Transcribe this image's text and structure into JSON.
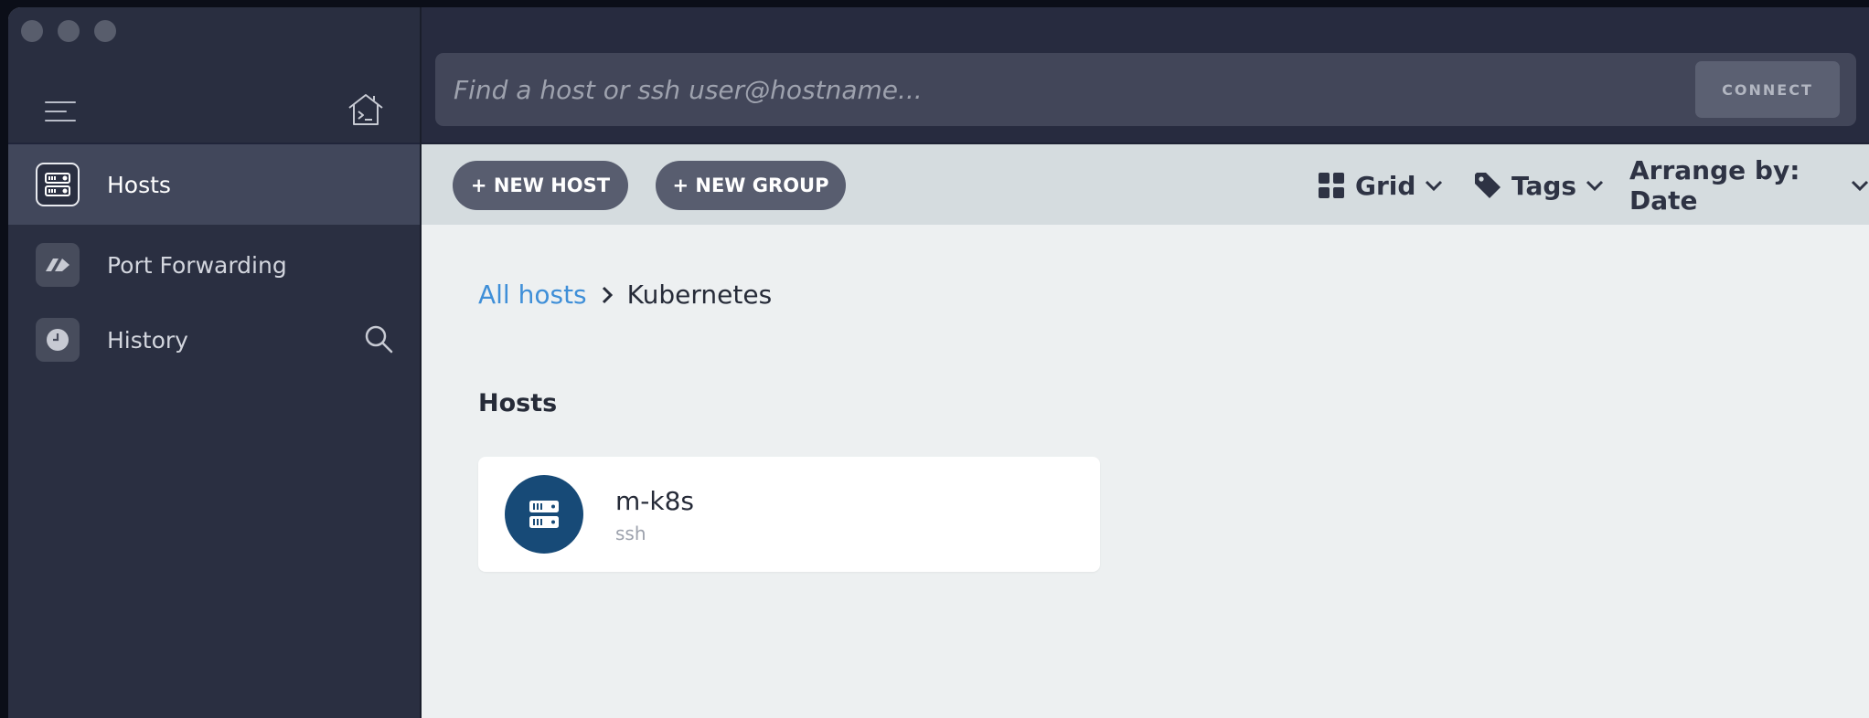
{
  "sidebar": {
    "items": [
      {
        "label": "Hosts",
        "icon": "server-icon",
        "active": true
      },
      {
        "label": "Port Forwarding",
        "icon": "forward-arrows-icon",
        "active": false
      },
      {
        "label": "History",
        "icon": "clock-icon",
        "active": false
      }
    ]
  },
  "search": {
    "placeholder": "Find a host or ssh user@hostname...",
    "value": "",
    "connect_label": "CONNECT"
  },
  "toolbar": {
    "new_host_label": "+ NEW HOST",
    "new_group_label": "+ NEW GROUP",
    "view_label": "Grid",
    "tags_label": "Tags",
    "arrange_label": "Arrange by: Date"
  },
  "breadcrumb": {
    "root": "All hosts",
    "current": "Kubernetes"
  },
  "hosts_section": {
    "title": "Hosts",
    "hosts": [
      {
        "name": "m-k8s",
        "protocol": "ssh"
      }
    ]
  },
  "colors": {
    "sidebar_bg": "#2a2f41",
    "accent_link": "#3f8fd8",
    "host_avatar_bg": "#174a77",
    "toolbar_bg": "#d5dcdf"
  }
}
